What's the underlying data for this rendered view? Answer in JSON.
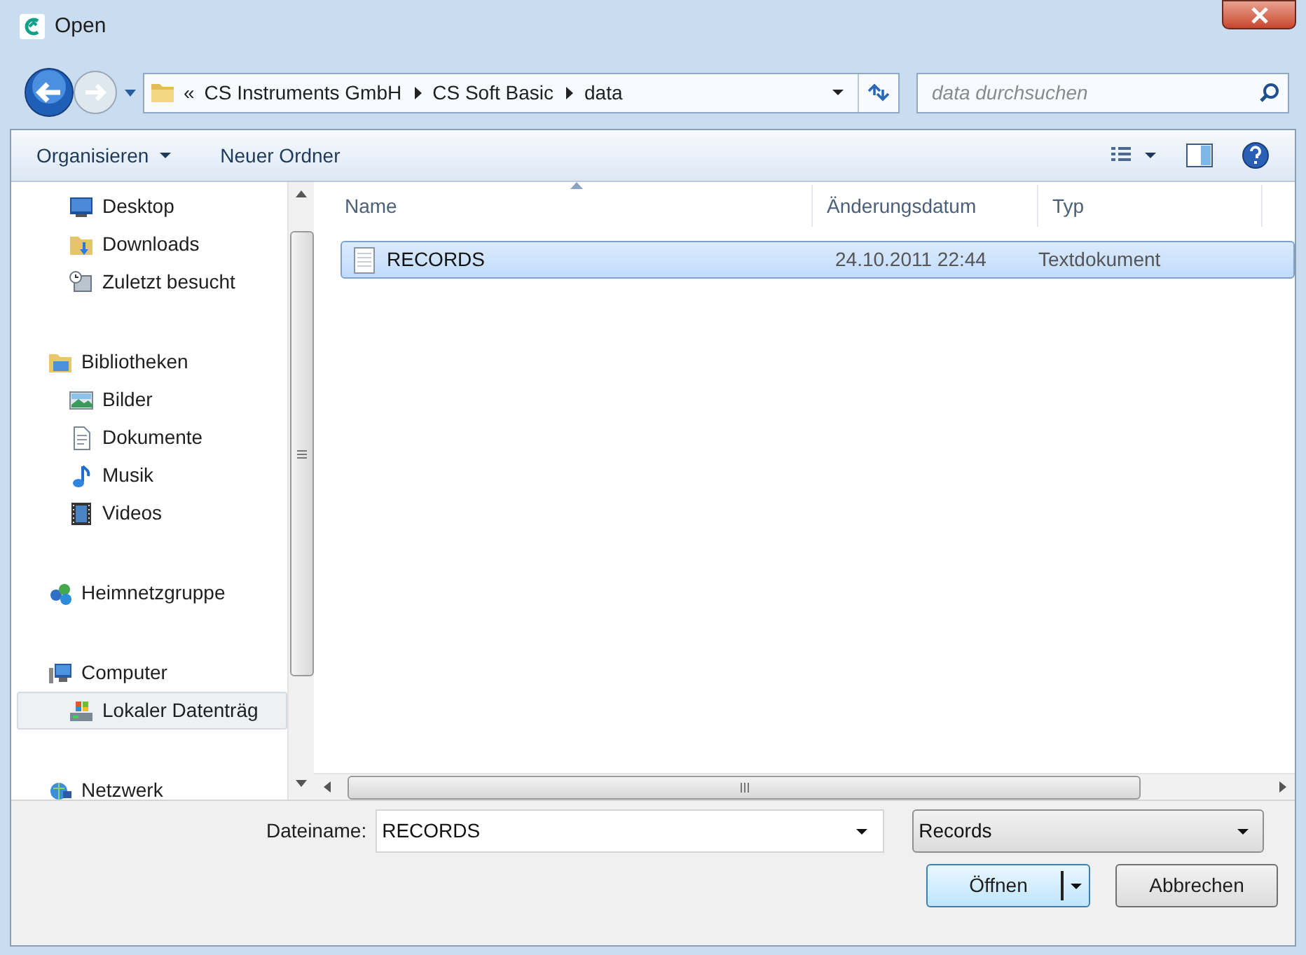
{
  "window": {
    "title": "Open"
  },
  "address_bar": {
    "overflow_chevron": "«",
    "breadcrumbs": [
      "CS Instruments GmbH",
      "CS Soft Basic",
      "data"
    ]
  },
  "search": {
    "placeholder": "data durchsuchen"
  },
  "toolbar": {
    "buttons": [
      {
        "label": "Organisieren",
        "kind": "menu"
      },
      {
        "label": "Neuer Ordner",
        "kind": "plain"
      }
    ]
  },
  "sidebar": {
    "items": [
      {
        "children": [
          {
            "label": "Desktop",
            "kind": "desktop",
            "selected": false
          },
          {
            "label": "Downloads",
            "kind": "downloads",
            "selected": false
          },
          {
            "label": "Zuletzt besucht",
            "kind": "recent",
            "selected": false
          }
        ]
      },
      {
        "label": "Bibliotheken",
        "kind": "libraries",
        "selected": false,
        "children": [
          {
            "label": "Bilder",
            "kind": "pictures",
            "selected": false
          },
          {
            "label": "Dokumente",
            "kind": "documents",
            "selected": false
          },
          {
            "label": "Musik",
            "kind": "music",
            "selected": false
          },
          {
            "label": "Videos",
            "kind": "videos",
            "selected": false
          }
        ]
      },
      {
        "label": "Heimnetzgruppe",
        "kind": "homegroup",
        "selected": false
      },
      {
        "label": "Computer",
        "kind": "computer",
        "selected": false,
        "children": [
          {
            "label": "Lokaler Datenträg",
            "kind": "drive",
            "selected": true
          }
        ]
      },
      {
        "label": "Netzwerk",
        "kind": "network",
        "selected": false
      }
    ]
  },
  "file_list": {
    "columns": [
      "Name",
      "Änderungsdatum",
      "Typ"
    ],
    "rows": [
      {
        "name": "RECORDS",
        "date": "24.10.2011 22:44",
        "type": "Textdokument",
        "selected": true
      }
    ]
  },
  "footer": {
    "filename_label": "Dateiname:",
    "filename_value": "RECORDS",
    "filter": "Records",
    "buttons": [
      {
        "label": "Öffnen",
        "kind": "split"
      },
      {
        "label": "Abbrechen",
        "kind": "plain"
      }
    ]
  }
}
